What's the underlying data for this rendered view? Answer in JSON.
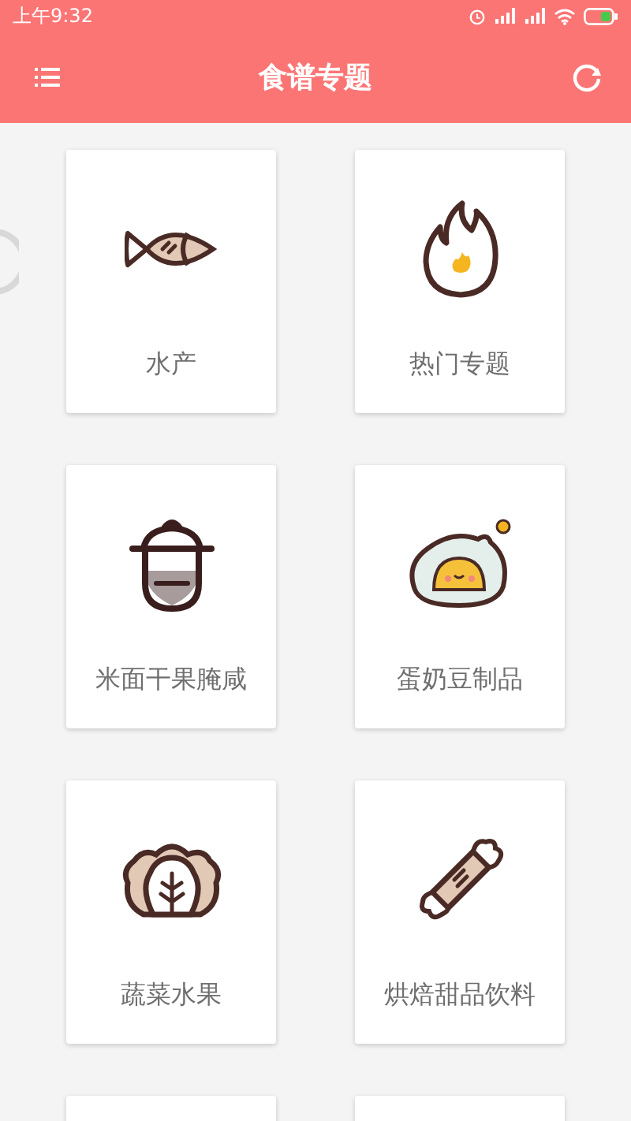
{
  "status_bar": {
    "time": "上午9:32"
  },
  "header": {
    "title": "食谱专题"
  },
  "categories": [
    {
      "kind": "fish",
      "label": "水产"
    },
    {
      "kind": "flame",
      "label": "热门专题"
    },
    {
      "kind": "pot",
      "label": "米面干果腌咸"
    },
    {
      "kind": "egg",
      "label": "蛋奶豆制品"
    },
    {
      "kind": "cabbage",
      "label": "蔬菜水果"
    },
    {
      "kind": "candy",
      "label": "烘焙甜品饮料"
    },
    {
      "kind": "hidden"
    },
    {
      "kind": "hidden"
    }
  ]
}
